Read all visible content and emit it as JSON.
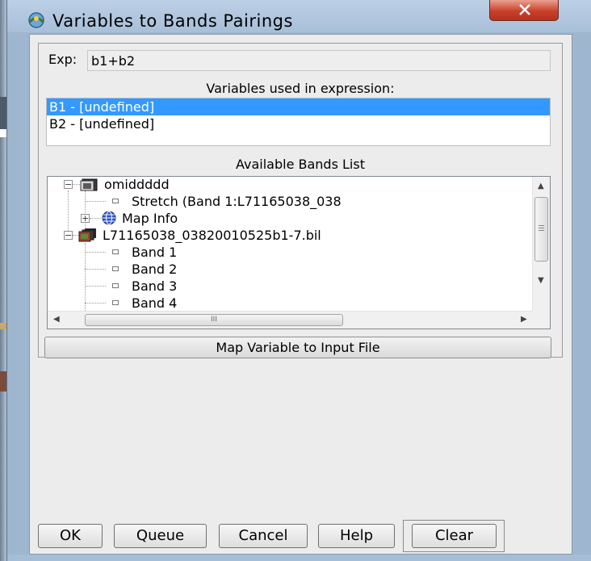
{
  "window": {
    "title": "Variables to Bands Pairings",
    "close_label": "x"
  },
  "expression": {
    "label": "Exp:",
    "value": "b1+b2"
  },
  "variables": {
    "label": "Variables used in expression:",
    "items": [
      {
        "text": "B1 - [undefined]",
        "selected": true
      },
      {
        "text": "B2 - [undefined]",
        "selected": false
      }
    ]
  },
  "bands": {
    "label": "Available Bands List",
    "tree": [
      {
        "text": "omiddddd",
        "type": "file"
      },
      {
        "text": "Stretch (Band 1:L71165038_038",
        "type": "band"
      },
      {
        "text": "Map Info",
        "type": "mapinfo"
      },
      {
        "text": "L71165038_03820010525b1-7.bil",
        "type": "file"
      },
      {
        "text": "Band 1",
        "type": "band"
      },
      {
        "text": "Band 2",
        "type": "band"
      },
      {
        "text": "Band 3",
        "type": "band"
      },
      {
        "text": "Band 4",
        "type": "band"
      }
    ],
    "h_thumb_grip": "III"
  },
  "buttons": {
    "map": "Map Variable to Input File",
    "ok": "OK",
    "queue": "Queue",
    "cancel": "Cancel",
    "help": "Help",
    "clear": "Clear"
  },
  "colors": {
    "selection": "#3399ff",
    "frame": "#9fb6cf",
    "close": "#c9402a"
  }
}
